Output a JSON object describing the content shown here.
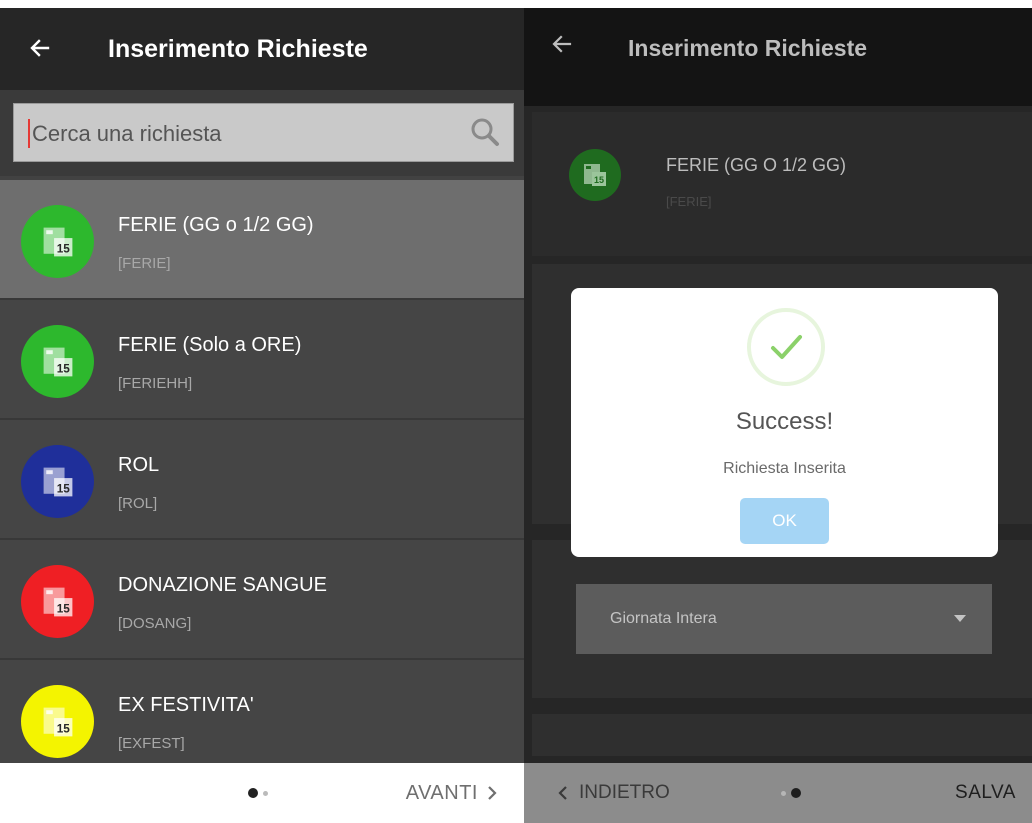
{
  "left": {
    "header": {
      "title": "Inserimento Richieste",
      "back_icon": "arrow-left-icon"
    },
    "search": {
      "placeholder": "Cerca una richiesta",
      "icon": "search-icon"
    },
    "items": [
      {
        "name": "FERIE (GG o 1/2 GG)",
        "code": "[FERIE]",
        "color": "#2db82d",
        "icon": "calendar-icon",
        "selected": true
      },
      {
        "name": "FERIE (Solo a ORE)",
        "code": "[FERIEHH]",
        "color": "#2db82d",
        "icon": "calendar-icon",
        "selected": false
      },
      {
        "name": "ROL",
        "code": "[ROL]",
        "color": "#1f2f9a",
        "icon": "calendar-icon",
        "selected": false
      },
      {
        "name": "DONAZIONE SANGUE",
        "code": "[DOSANG]",
        "color": "#ef1f24",
        "icon": "calendar-icon",
        "selected": false
      },
      {
        "name": "EX FESTIVITA'",
        "code": "[EXFEST]",
        "color": "#f4f400",
        "icon": "calendar-icon",
        "selected": false
      }
    ],
    "footer": {
      "next_label": "AVANTI",
      "next_icon": "chevron-right-icon",
      "page": 1,
      "pages": 2
    }
  },
  "right": {
    "header": {
      "title": "Inserimento Richieste",
      "back_icon": "arrow-left-icon"
    },
    "selected_request": {
      "name": "FERIE (GG O 1/2 GG)",
      "code": "[FERIE]",
      "color": "#1f6b1f"
    },
    "duration_select": {
      "value": "Giornata Intera",
      "icon": "caret-down-icon"
    },
    "footer": {
      "back_label": "INDIETRO",
      "save_label": "SALVA",
      "page": 2,
      "pages": 2
    }
  },
  "dialog": {
    "icon": "checkmark-icon",
    "title": "Success!",
    "message": "Richiesta Inserita",
    "ok_label": "OK",
    "check_color": "#8bd16a",
    "ok_color": "#a5d5f5"
  }
}
